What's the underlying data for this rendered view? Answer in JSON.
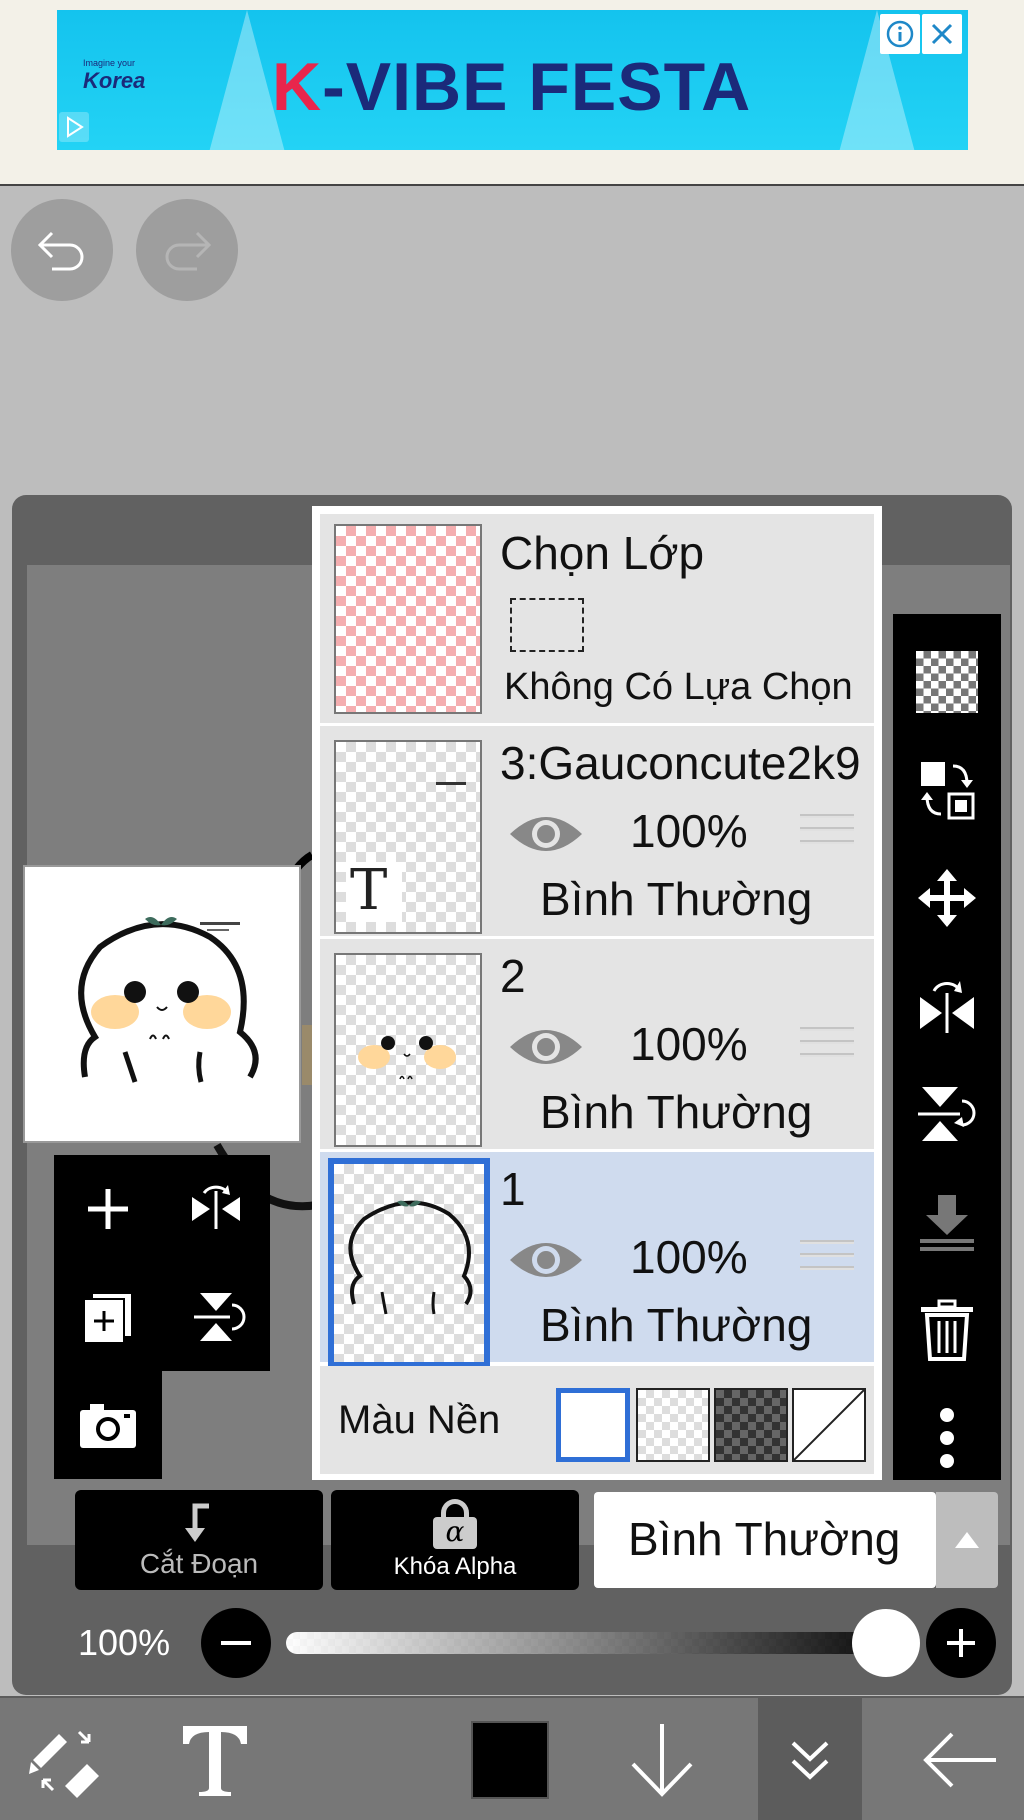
{
  "ad": {
    "title_k": "K",
    "title_rest": "-VIBE FESTA",
    "logo_small": "Imagine your",
    "logo_text": "Korea"
  },
  "layers_panel": {
    "selection_layer": {
      "title": "Chọn Lớp",
      "status": "Không Có Lựa Chọn"
    },
    "layers": [
      {
        "name": "3:Gauconcute2k9",
        "opacity": "100%",
        "blend": "Bình Thường",
        "thumb_letter": "T"
      },
      {
        "name": "2",
        "opacity": "100%",
        "blend": "Bình Thường"
      },
      {
        "name": "1",
        "opacity": "100%",
        "blend": "Bình Thường",
        "selected": true
      }
    ],
    "background": {
      "label": "Màu Nền"
    }
  },
  "controls": {
    "clip_label": "Cắt Đoạn",
    "alpha_lock_label": "Khóa Alpha",
    "alpha_symbol": "α",
    "blend_mode": "Bình Thường",
    "opacity_label": "100%",
    "opacity_value": 100
  },
  "colors": {
    "selected_layer": "#cfdbee",
    "selection_outline": "#2f6fd6",
    "ad_background": "#14c3ee",
    "ad_title": "#1b2a7a",
    "ad_accent": "#e8264c",
    "foreground_color": "#000000"
  },
  "icons": {
    "top": [
      "undo-icon",
      "redo-icon"
    ],
    "left_tools": [
      "add-layer-icon",
      "flip-horizontal-icon",
      "duplicate-layer-icon",
      "flip-vertical-icon",
      "camera-icon"
    ],
    "right_tools": [
      "transparent-fill-icon",
      "swap-icon",
      "move-icon",
      "flip-horizontal-icon",
      "flip-vertical-icon",
      "merge-down-icon",
      "trash-icon",
      "more-icon"
    ],
    "bottom_nav": [
      "brush-eraser-icon",
      "text-tool-icon",
      "color-swatch",
      "arrow-down-icon",
      "collapse-icon",
      "back-arrow-icon"
    ]
  }
}
